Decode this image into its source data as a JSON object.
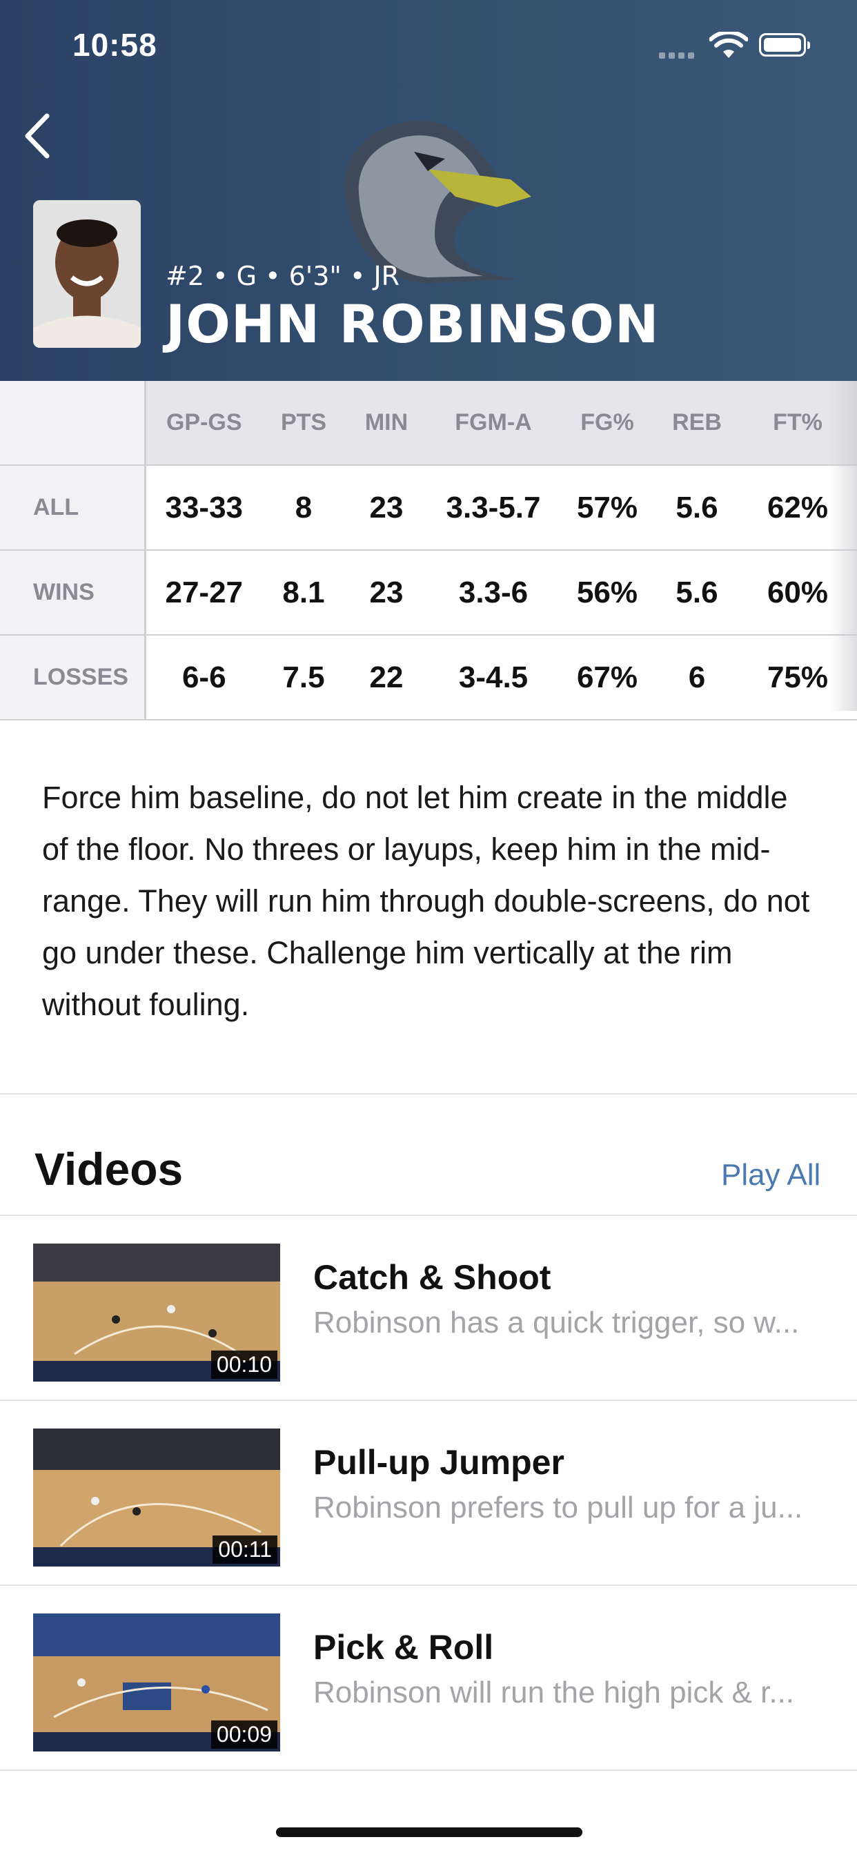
{
  "status_bar": {
    "time": "10:58"
  },
  "player": {
    "meta": "#2 • G • 6'3\" • JR",
    "name": "JOHN ROBINSON"
  },
  "stats": {
    "columns": [
      "GP-GS",
      "PTS",
      "MIN",
      "FGM-A",
      "FG%",
      "REB",
      "FT%"
    ],
    "rows": [
      {
        "label": "ALL",
        "values": [
          "33-33",
          "8",
          "23",
          "3.3-5.7",
          "57%",
          "5.6",
          "62%"
        ]
      },
      {
        "label": "WINS",
        "values": [
          "27-27",
          "8.1",
          "23",
          "3.3-6",
          "56%",
          "5.6",
          "60%"
        ]
      },
      {
        "label": "LOSSES",
        "values": [
          "6-6",
          "7.5",
          "22",
          "3-4.5",
          "67%",
          "6",
          "75%"
        ]
      }
    ]
  },
  "scouting_note": "Force him baseline, do not let him create in the middle of the floor. No threes or layups, keep him in the mid-range. They will run him through double-screens, do not go under these. Challenge him vertically at the rim without fouling.",
  "videos": {
    "title": "Videos",
    "play_all": "Play All",
    "items": [
      {
        "title": "Catch & Shoot",
        "desc": "Robinson has a quick trigger, so w...",
        "duration": "00:10"
      },
      {
        "title": "Pull-up Jumper",
        "desc": "Robinson prefers to pull up for a ju...",
        "duration": "00:11"
      },
      {
        "title": "Pick & Roll",
        "desc": "Robinson will run the high pick & r...",
        "duration": "00:09"
      }
    ]
  },
  "colors": {
    "header_bg": "#2b4266",
    "accent": "#4b7ab0",
    "mascot_beak": "#b9b53a"
  },
  "icons": {
    "back": "chevron-left-icon",
    "wifi": "wifi-icon",
    "battery": "battery-icon",
    "signal": "cellular-signal-icon"
  }
}
